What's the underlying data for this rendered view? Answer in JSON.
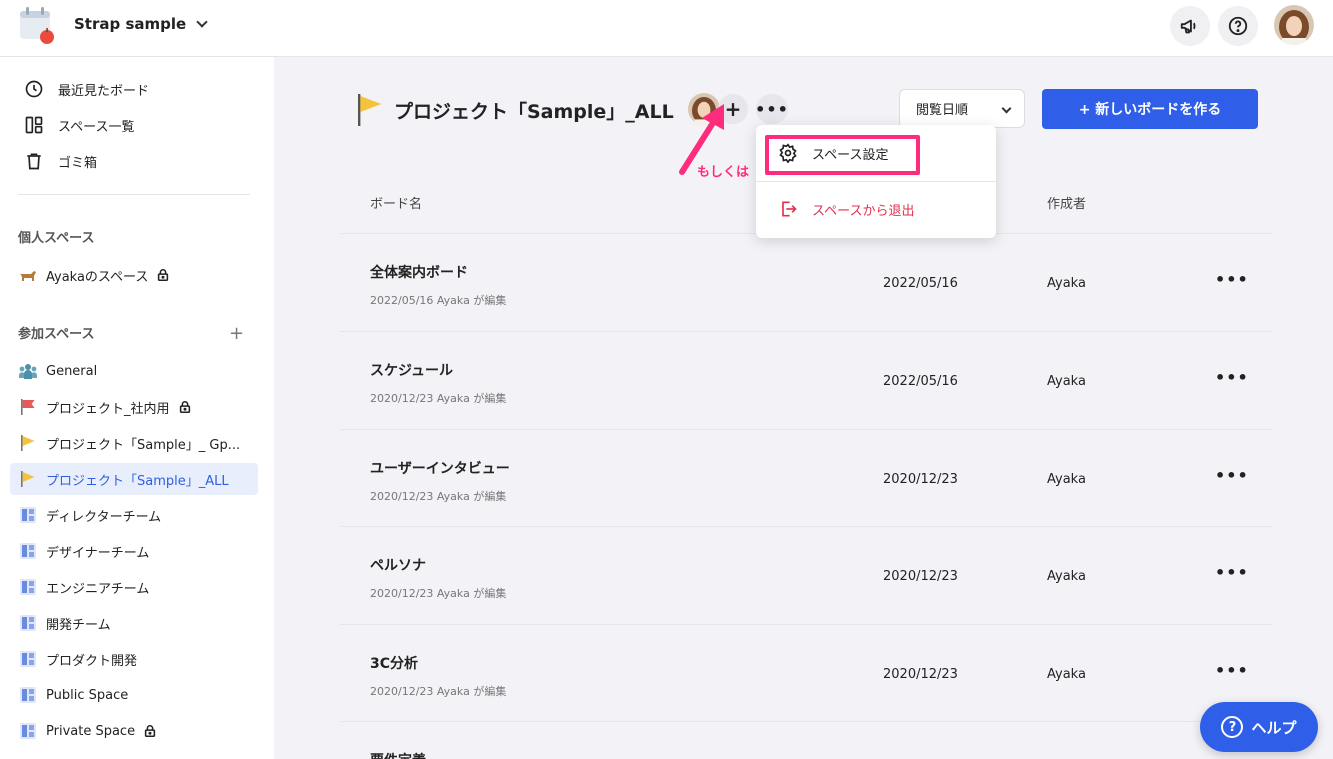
{
  "header": {
    "workspace_name": "Strap sample"
  },
  "sidebar": {
    "nav": [
      {
        "label": "最近見たボード",
        "icon": "clock-icon"
      },
      {
        "label": "スペース一覧",
        "icon": "grid-icon"
      },
      {
        "label": "ゴミ箱",
        "icon": "trash-icon"
      }
    ],
    "personal_title": "個人スペース",
    "personal_space": "Ayakaのスペース",
    "joined_title": "参加スペース",
    "add_label": "+",
    "spaces": [
      {
        "label": "General",
        "icon": "team-icon"
      },
      {
        "label": "プロジェクト_社内用",
        "icon": "red-flag-icon"
      },
      {
        "label": "プロジェクト「Sample」_ Gp...",
        "icon": "yellow-flag-icon"
      },
      {
        "label": "プロジェクト「Sample」_ALL",
        "icon": "yellow-flag-icon"
      },
      {
        "label": "ディレクターチーム",
        "icon": "board-icon"
      },
      {
        "label": "デザイナーチーム",
        "icon": "board-icon"
      },
      {
        "label": "エンジニアチーム",
        "icon": "board-icon"
      },
      {
        "label": "開発チーム",
        "icon": "board-icon"
      },
      {
        "label": "プロダクト開発",
        "icon": "board-icon"
      },
      {
        "label": "Public Space",
        "icon": "board-icon"
      },
      {
        "label": "Private Space",
        "icon": "board-icon"
      }
    ]
  },
  "main": {
    "title": "プロジェクト「Sample」_ALL",
    "add_member": "+",
    "more": "•••",
    "sort_label": "閲覧日順",
    "new_board_label": "+ 新しいボードを作る",
    "columns": {
      "name": "ボード名",
      "author": "作成者"
    },
    "boards": [
      {
        "name": "全体案内ボード",
        "sub": "2022/05/16 Ayaka が編集",
        "date": "2022/05/16",
        "author": "Ayaka"
      },
      {
        "name": "スケジュール",
        "sub": "2020/12/23 Ayaka が編集",
        "date": "2022/05/16",
        "author": "Ayaka"
      },
      {
        "name": "ユーザーインタビュー",
        "sub": "2020/12/23 Ayaka が編集",
        "date": "2020/12/23",
        "author": "Ayaka"
      },
      {
        "name": "ペルソナ",
        "sub": "2020/12/23 Ayaka が編集",
        "date": "2020/12/23",
        "author": "Ayaka"
      },
      {
        "name": "3C分析",
        "sub": "2020/12/23 Ayaka が編集",
        "date": "2020/12/23",
        "author": "Ayaka"
      },
      {
        "name": "要件定義",
        "sub": "",
        "date": "",
        "author": ""
      }
    ],
    "row_more": "•••"
  },
  "dropdown": {
    "space_settings": "スペース設定",
    "leave_space": "スペースから退出"
  },
  "annotation": {
    "text": "もしくは"
  },
  "help": {
    "label": "ヘルプ",
    "icon_glyph": "?"
  },
  "colors": {
    "accent": "#2f5fe8",
    "highlight": "#ff2c7d",
    "danger": "#e0314f"
  }
}
